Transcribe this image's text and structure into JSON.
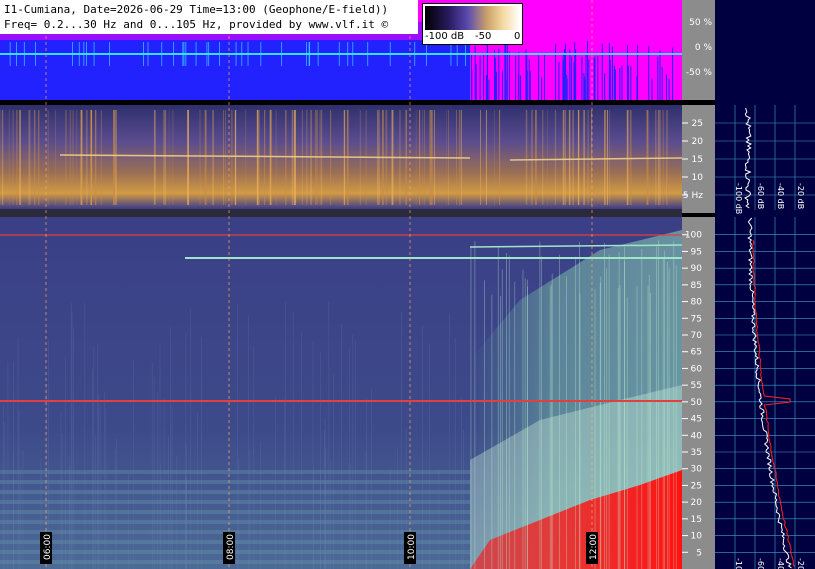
{
  "header": {
    "line1": "I1-Cumiana, Date=2026-06-29 Time=13:00 (Geophone/E-field))",
    "line2": "Freq= 0.2...30 Hz and 0...105 Hz, provided by www.vlf.it ©"
  },
  "colorbar": {
    "ticks": [
      "-100 dB",
      "-50",
      "0"
    ]
  },
  "colors": {
    "magenta": "#ff00ff",
    "blue": "#2222ff",
    "cyan": "#35e0ff",
    "red": "#ff1111",
    "panel_bg": "#3b3f86",
    "gray_axis": "#8c8c8c",
    "navy": "#000040"
  },
  "chart_data": [
    {
      "type": "area",
      "panel": "amplitude",
      "ytick_labels": [
        "50 %",
        "0 %",
        "-50 %"
      ],
      "yticks": [
        50,
        0,
        -50
      ],
      "ylim": [
        -100,
        100
      ]
    },
    {
      "type": "heatmap",
      "panel": "low_frequency_spectrogram",
      "ytick_labels": [
        "25",
        "20",
        "15",
        "10",
        "5 Hz"
      ],
      "yticks": [
        25,
        20,
        15,
        10,
        5
      ],
      "ylim": [
        0,
        30
      ]
    },
    {
      "type": "heatmap",
      "panel": "spectrogram_0_105_Hz",
      "ytick_labels": [
        "100",
        "95",
        "90",
        "85",
        "80",
        "75",
        "70",
        "65",
        "60",
        "55",
        "50",
        "45",
        "40",
        "35",
        "30",
        "25",
        "20",
        "15",
        "10",
        "5"
      ],
      "yticks": [
        100,
        95,
        90,
        85,
        80,
        75,
        70,
        65,
        60,
        55,
        50,
        45,
        40,
        35,
        30,
        25,
        20,
        15,
        10,
        5
      ],
      "ylim": [
        0,
        105
      ],
      "x_labels": [
        "06:00",
        "08:00",
        "10:00",
        "12:00"
      ],
      "annotated_lines_hz": [
        50,
        91,
        95
      ]
    },
    {
      "type": "line",
      "panel": "side_profile",
      "x_labels": [
        "-100 dB",
        "-60 dB",
        "-40 dB",
        "-20 dB"
      ]
    }
  ]
}
